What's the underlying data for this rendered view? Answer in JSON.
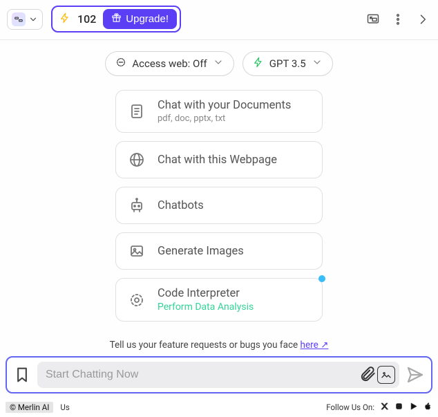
{
  "header": {
    "credits": "102",
    "upgrade_label": "Upgrade!"
  },
  "options": {
    "web_access_label": "Access web: Off",
    "model_label": "GPT 3.5"
  },
  "cards": [
    {
      "title": "Chat with your Documents",
      "subtitle": "pdf, doc, pptx, txt"
    },
    {
      "title": "Chat with this Webpage"
    },
    {
      "title": "Chatbots"
    },
    {
      "title": "Generate Images"
    },
    {
      "title": "Code Interpreter",
      "subtitle_green": "Perform Data Analysis",
      "has_dot": true
    }
  ],
  "feedback": {
    "text": "Tell us your feature requests or bugs you face ",
    "link_text": "here ↗"
  },
  "composer": {
    "placeholder": "Start Chatting Now"
  },
  "footer": {
    "watermark": "© Merlin AI",
    "contact": "Us",
    "follow": "Follow Us On:"
  }
}
